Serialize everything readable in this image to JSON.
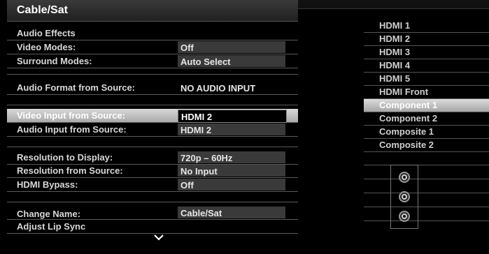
{
  "title": "Cable/Sat",
  "settings": [
    {
      "label": "Audio Effects",
      "value": null
    },
    {
      "label": "Video Modes:",
      "value": "Off"
    },
    {
      "label": "Surround Modes:",
      "value": "Auto Select"
    },
    {
      "label": "Audio Format from Source:",
      "value": "NO AUDIO INPUT"
    },
    {
      "label": "Video Input from Source:",
      "value": "HDMI 2"
    },
    {
      "label": "Audio Input from Source:",
      "value": "HDMI 2"
    },
    {
      "label": "Resolution to Display:",
      "value": "720p – 60Hz"
    },
    {
      "label": "Resolution from Source:",
      "value": "No Input"
    },
    {
      "label": "HDMI Bypass:",
      "value": "Off"
    },
    {
      "label": "Change Name:",
      "value": "Cable/Sat"
    },
    {
      "label": "Adjust Lip Sync",
      "value": null
    }
  ],
  "sources": [
    "HDMI 1",
    "HDMI 2",
    "HDMI 3",
    "HDMI 4",
    "HDMI 5",
    "HDMI Front",
    "Component 1",
    "Component 2",
    "Composite 1",
    "Composite 2"
  ],
  "selected_source": "Component 1",
  "icons": {
    "more": "chevron-down-icon",
    "jack": "rca-jack-icon"
  }
}
